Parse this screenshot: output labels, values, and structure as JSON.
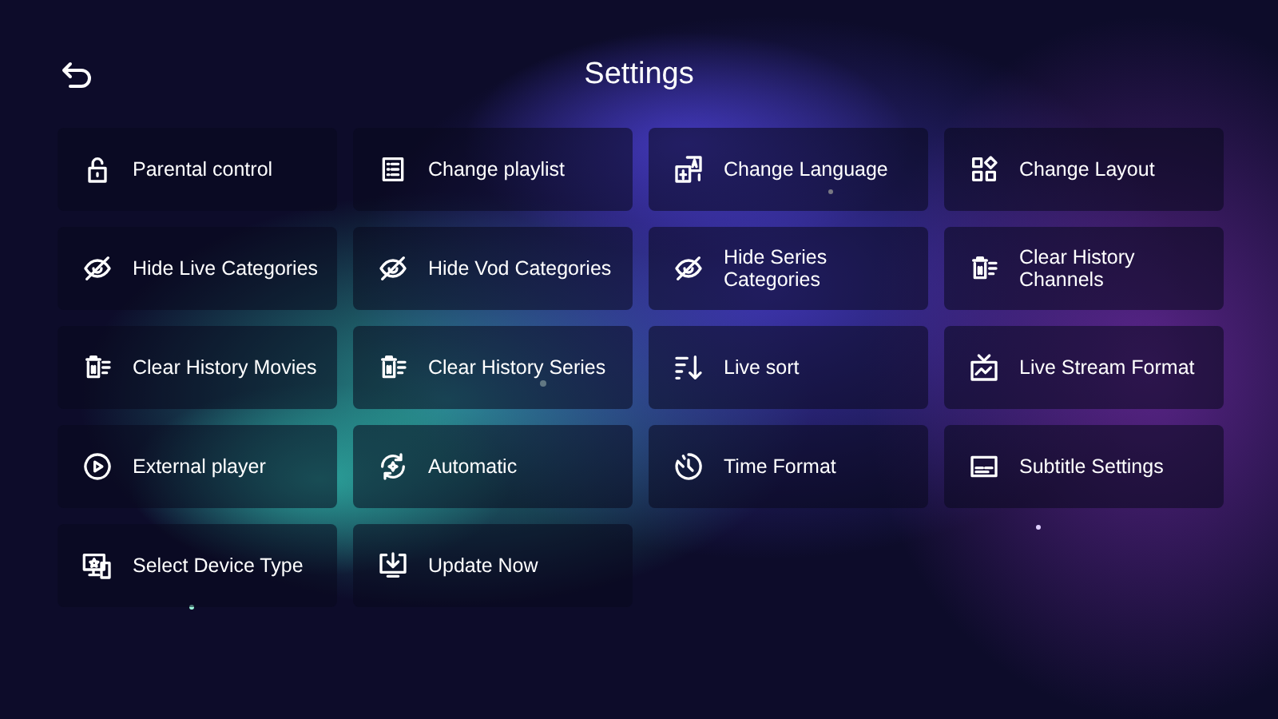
{
  "header": {
    "title": "Settings"
  },
  "items": [
    {
      "label": "Parental control"
    },
    {
      "label": "Change playlist"
    },
    {
      "label": "Change Language"
    },
    {
      "label": "Change Layout"
    },
    {
      "label": "Hide Live Categories"
    },
    {
      "label": "Hide Vod Categories"
    },
    {
      "label": "Hide Series Categories"
    },
    {
      "label": "Clear History Channels"
    },
    {
      "label": "Clear History Movies"
    },
    {
      "label": "Clear History Series"
    },
    {
      "label": "Live sort"
    },
    {
      "label": "Live Stream Format"
    },
    {
      "label": "External player"
    },
    {
      "label": "Automatic"
    },
    {
      "label": "Time Format"
    },
    {
      "label": "Subtitle Settings"
    },
    {
      "label": "Select Device Type"
    },
    {
      "label": "Update Now"
    }
  ]
}
